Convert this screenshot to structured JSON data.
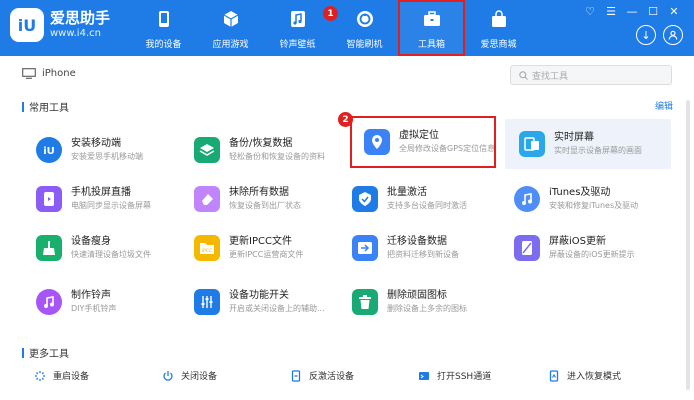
{
  "app": {
    "logo_badge": "iU",
    "name": "爱思助手",
    "url": "www.i4.cn"
  },
  "nav": [
    {
      "label": "我的设备",
      "icon": "phone-icon"
    },
    {
      "label": "应用游戏",
      "icon": "app-cube-icon"
    },
    {
      "label": "铃声壁纸",
      "icon": "music-icon"
    },
    {
      "label": "智能刷机",
      "icon": "flash-icon"
    },
    {
      "label": "工具箱",
      "icon": "toolbox-icon",
      "active": true
    },
    {
      "label": "爱思商城",
      "icon": "shop-bag-icon"
    }
  ],
  "annotations": {
    "nav_marker": "1",
    "tool_marker": "2"
  },
  "device": {
    "name": "iPhone"
  },
  "search": {
    "placeholder": "查找工具"
  },
  "sections": {
    "common": "常用工具",
    "more": "更多工具",
    "edit": "编辑"
  },
  "tools": [
    {
      "name": "安装移动端",
      "desc": "安装爱思手机移动端",
      "icon": "i4-app-icon",
      "color": "#1f7ce6"
    },
    {
      "name": "备份/恢复数据",
      "desc": "轻松备份和恢复设备的资料",
      "icon": "layers-icon",
      "color": "#19a974"
    },
    {
      "name": "虚拟定位",
      "desc": "全局修改设备GPS定位信息",
      "icon": "location-pin-icon",
      "color": "#3b82f6"
    },
    {
      "name": "实时屏幕",
      "desc": "实时显示设备屏幕的画面",
      "icon": "screen-icon",
      "color": "#2aa7e8"
    },
    {
      "name": "手机投屏直播",
      "desc": "电脑同步显示设备屏幕",
      "icon": "cast-icon",
      "color": "#8b5cf6"
    },
    {
      "name": "抹除所有数据",
      "desc": "恢复设备到出厂状态",
      "icon": "eraser-icon",
      "color": "#c084fc"
    },
    {
      "name": "批量激活",
      "desc": "支持多台设备同时激活",
      "icon": "shield-icon",
      "color": "#1f7ce6"
    },
    {
      "name": "iTunes及驱动",
      "desc": "安装和修复iTunes及驱动",
      "icon": "itunes-icon",
      "color": "#4f8ef7"
    },
    {
      "name": "设备瘦身",
      "desc": "快速清理设备垃圾文件",
      "icon": "broom-icon",
      "color": "#19b06e"
    },
    {
      "name": "更新IPCC文件",
      "desc": "更新IPCC运营商文件",
      "icon": "ipcc-folder-icon",
      "color": "#f5b800"
    },
    {
      "name": "迁移设备数据",
      "desc": "把资料迁移到新设备",
      "icon": "migrate-icon",
      "color": "#3b82f6"
    },
    {
      "name": "屏蔽iOS更新",
      "desc": "屏蔽设备的iOS更新提示",
      "icon": "block-update-icon",
      "color": "#7c6cf0"
    },
    {
      "name": "制作铃声",
      "desc": "DIY手机铃声",
      "icon": "ringtone-icon",
      "color": "#a855f7"
    },
    {
      "name": "设备功能开关",
      "desc": "开启或关闭设备上的辅助...",
      "icon": "switch-icon",
      "color": "#1f7ce6"
    },
    {
      "name": "删除顽固图标",
      "desc": "删除设备上多余的图标",
      "icon": "trash-icon",
      "color": "#19a974"
    }
  ],
  "more_tools": [
    {
      "label": "重启设备",
      "icon": "restart-icon"
    },
    {
      "label": "关闭设备",
      "icon": "power-icon"
    },
    {
      "label": "反激活设备",
      "icon": "deactivate-icon"
    },
    {
      "label": "打开SSH通道",
      "icon": "ssh-icon"
    },
    {
      "label": "进入恢复模式",
      "icon": "recovery-icon"
    }
  ],
  "colors": {
    "topbar": "#1f7ce6",
    "highlight": "#e02020",
    "accent": "#1f7ce6"
  }
}
